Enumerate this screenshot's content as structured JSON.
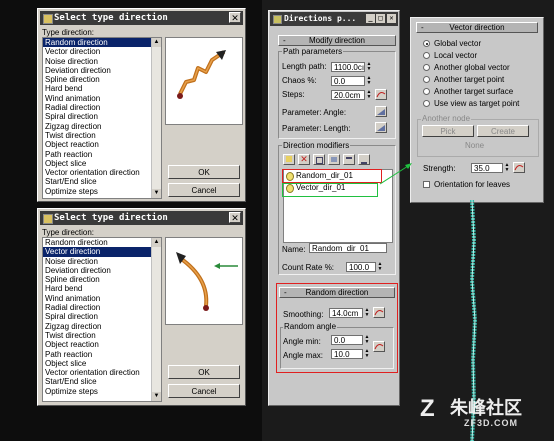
{
  "dialog1": {
    "title": "Select type direction",
    "label": "Type direction:",
    "items": [
      "Random direction",
      "Vector direction",
      "Noise direction",
      "Deviation direction",
      "Spline direction",
      "Hard bend",
      "Wind animation",
      "Radial direction",
      "Spiral direction",
      "Zigzag direction",
      "Twist direction",
      "Object reaction",
      "Path reaction",
      "Object slice",
      "Vector orientation direction",
      "Start/End slice",
      "Optimize steps"
    ],
    "selected": "Random direction",
    "ok": "OK",
    "cancel": "Cancel"
  },
  "dialog2": {
    "title": "Select type direction",
    "label": "Type direction:",
    "items": [
      "Random direction",
      "Vector direction",
      "Noise direction",
      "Deviation direction",
      "Spline direction",
      "Hard bend",
      "Wind animation",
      "Radial direction",
      "Spiral direction",
      "Zigzag direction",
      "Twist direction",
      "Object reaction",
      "Path reaction",
      "Object slice",
      "Vector orientation direction",
      "Start/End slice",
      "Optimize steps"
    ],
    "selected": "Vector direction",
    "ok": "OK",
    "cancel": "Cancel"
  },
  "directions_panel": {
    "title": "Directions p...",
    "modify_rollout": "Modify direction",
    "path_params_group": "Path parameters",
    "length_label": "Length path:",
    "length_value": "1100.0cı",
    "chaos_label": "Chaos %:",
    "chaos_value": "0.0",
    "steps_label": "Steps:",
    "steps_value": "20.0cm",
    "param_angle_label": "Parameter: Angle:",
    "param_length_label": "Parameter: Length:",
    "modifiers_group": "Direction modifiers",
    "modifiers": [
      "Random_dir_01",
      "Vector_dir_01"
    ],
    "name_label": "Name:",
    "name_value": "Random_dir_01",
    "count_rate_label": "Count Rate %:",
    "count_rate_value": "100.0",
    "random_rollout": "Random direction",
    "smoothing_label": "Smoothing:",
    "smoothing_value": "14.0cm",
    "random_angle_group": "Random angle",
    "angle_min_label": "Angle min:",
    "angle_min_value": "0.0",
    "angle_max_label": "Angle max:",
    "angle_max_value": "10.0"
  },
  "vector_panel": {
    "rollout": "Vector direction",
    "options": [
      "Global vector",
      "Local vector",
      "Another global vector",
      "Another target point",
      "Another target surface",
      "Use view as target point"
    ],
    "selected": "Global vector",
    "another_node_group": "Another node",
    "pick": "Pick",
    "create": "Create",
    "none": "None",
    "strength_label": "Strength:",
    "strength_value": "35.0",
    "orientation_label": "Orientation for leaves"
  },
  "watermark": {
    "text": "朱峰社区",
    "sub": "ZF3D.COM"
  }
}
